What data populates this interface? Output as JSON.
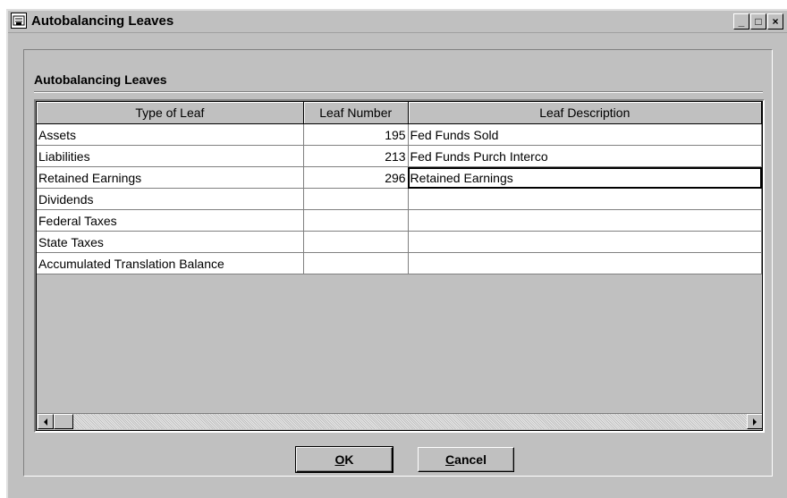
{
  "window": {
    "title": "Autobalancing Leaves",
    "buttons": {
      "minimize": "_",
      "maximize": "□",
      "close": "×"
    }
  },
  "group": {
    "label": "Autobalancing Leaves"
  },
  "grid": {
    "columns": [
      "Type of Leaf",
      "Leaf Number",
      "Leaf Description"
    ],
    "rows": [
      {
        "type": "Assets",
        "number": "195",
        "description": "Fed Funds Sold"
      },
      {
        "type": "Liabilities",
        "number": "213",
        "description": "Fed Funds Purch Interco"
      },
      {
        "type": "Retained Earnings",
        "number": "296",
        "description": "Retained Earnings"
      },
      {
        "type": "Dividends",
        "number": "",
        "description": ""
      },
      {
        "type": "Federal Taxes",
        "number": "",
        "description": ""
      },
      {
        "type": "State Taxes",
        "number": "",
        "description": ""
      },
      {
        "type": "Accumulated Translation Balance",
        "number": "",
        "description": ""
      }
    ]
  },
  "buttons": {
    "ok_mnemonic": "O",
    "ok_rest": "K",
    "cancel_mnemonic": "C",
    "cancel_rest": "ancel"
  }
}
